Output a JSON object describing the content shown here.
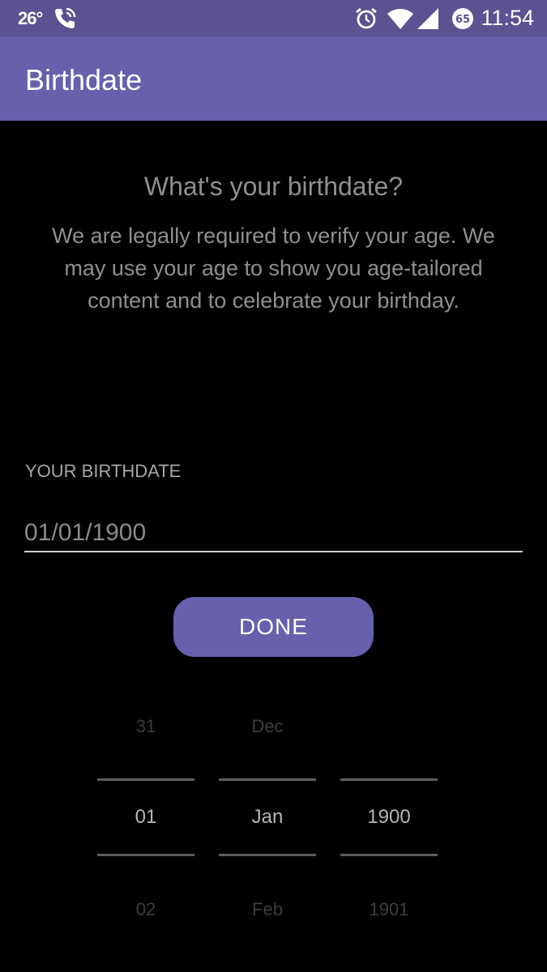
{
  "status_bar": {
    "temperature": "26°",
    "time": "11:54",
    "badge": "65",
    "icons": [
      "phone-call-icon",
      "alarm-clock-icon",
      "wifi-icon",
      "cell-signal-icon",
      "data-saver-badge-icon"
    ]
  },
  "app_bar": {
    "title": "Birthdate"
  },
  "content": {
    "heading": "What's your birthdate?",
    "description": "We are legally required to verify your age. We may use your age to show you age-tailored content and to celebrate your birthday."
  },
  "birthdate_field": {
    "label": "YOUR BIRTHDATE",
    "placeholder": "01/01/1900",
    "value": ""
  },
  "done_button": {
    "label": "DONE"
  },
  "picker": {
    "day": {
      "prev": "31",
      "selected": "01",
      "next": "02"
    },
    "month": {
      "prev": "Dec",
      "selected": "Jan",
      "next": "Feb"
    },
    "year": {
      "prev": "",
      "selected": "1900",
      "next": "1901"
    }
  },
  "colors": {
    "status_bar": "#5a5291",
    "accent": "#6760ad",
    "background": "#000000"
  }
}
